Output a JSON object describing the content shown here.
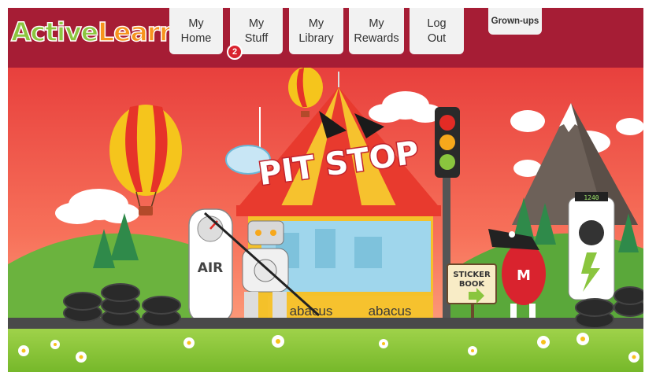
{
  "brand": {
    "logo_part1": "Active",
    "logo_part2": "Learn"
  },
  "nav": [
    {
      "line1": "My",
      "line2": "Home"
    },
    {
      "line1": "My",
      "line2": "Stuff"
    },
    {
      "line1": "My",
      "line2": "Library"
    },
    {
      "line1": "My",
      "line2": "Rewards"
    },
    {
      "line1": "Log",
      "line2": "Out"
    }
  ],
  "stuff_badge": "2",
  "grownups_label": "Grown-ups",
  "scene": {
    "pit_stop_sign": "PIT STOP",
    "air_label": "AIR",
    "sticker_book_line1": "STICKER",
    "sticker_book_line2": "BOOK",
    "stand_label_left": "abacus",
    "stand_label_right": "abacus",
    "pump_display": "1240",
    "mascot_letter": "M"
  },
  "colors": {
    "header": "#a61d35",
    "sky_top": "#f04a43",
    "sky_bottom": "#ffa880",
    "grass": "#8dc63f",
    "road": "#4a4a4a"
  }
}
